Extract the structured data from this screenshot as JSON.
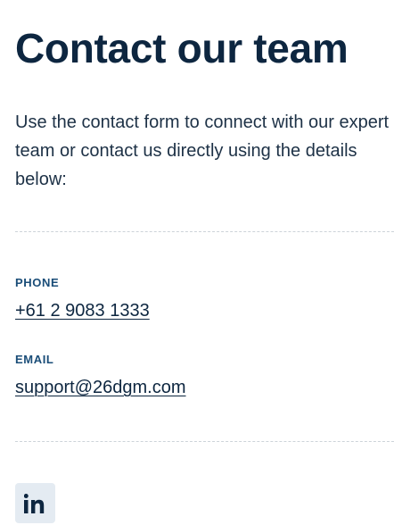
{
  "heading": {
    "title": "Contact our team"
  },
  "intro": {
    "text": "Use the contact form to connect with our expert team or contact us directly using the details below:"
  },
  "contact": {
    "phone": {
      "label": "PHONE",
      "value": "+61 2 9083 1333"
    },
    "email": {
      "label": "EMAIL",
      "value": "support@26dgm.com"
    }
  },
  "social": {
    "icons": [
      "linkedin-icon"
    ],
    "linkedin_text": "in"
  },
  "colors": {
    "heading": "#0d2640",
    "label": "#1a4d78",
    "social_bg": "#e4ebf2"
  }
}
